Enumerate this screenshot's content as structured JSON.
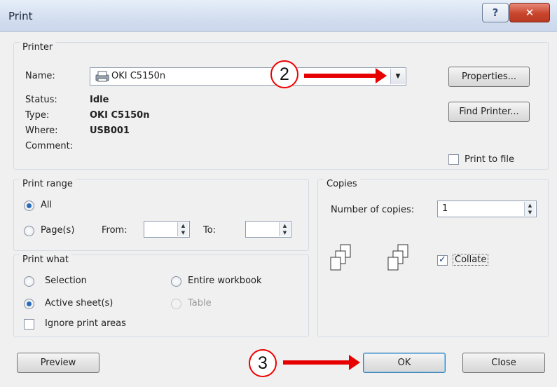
{
  "window": {
    "title": "Print",
    "help_glyph": "?",
    "close_glyph": "✕"
  },
  "printer": {
    "group_label": "Printer",
    "name_label": "Name:",
    "name_value": "OKI C5150n",
    "status_label": "Status:",
    "status_value": "Idle",
    "type_label": "Type:",
    "type_value": "OKI C5150n",
    "where_label": "Where:",
    "where_value": "USB001",
    "comment_label": "Comment:",
    "properties_button": "Properties...",
    "find_printer_button": "Find Printer...",
    "print_to_file_label": "Print to file"
  },
  "print_range": {
    "group_label": "Print range",
    "all_label": "All",
    "pages_label": "Page(s)",
    "from_label": "From:",
    "to_label": "To:",
    "selected": "All"
  },
  "print_what": {
    "group_label": "Print what",
    "selection_label": "Selection",
    "entire_workbook_label": "Entire workbook",
    "active_sheets_label": "Active sheet(s)",
    "table_label": "Table",
    "ignore_print_areas_label": "Ignore print areas",
    "selected": "Active sheet(s)"
  },
  "copies": {
    "group_label": "Copies",
    "number_label": "Number of copies:",
    "number_value": "1",
    "collate_label": "Collate",
    "collate_checked": true
  },
  "footer": {
    "preview_button": "Preview",
    "ok_button": "OK",
    "close_button": "Close"
  },
  "annotations": {
    "callout_2": "2",
    "callout_3": "3",
    "accent_color": "#e60000"
  }
}
